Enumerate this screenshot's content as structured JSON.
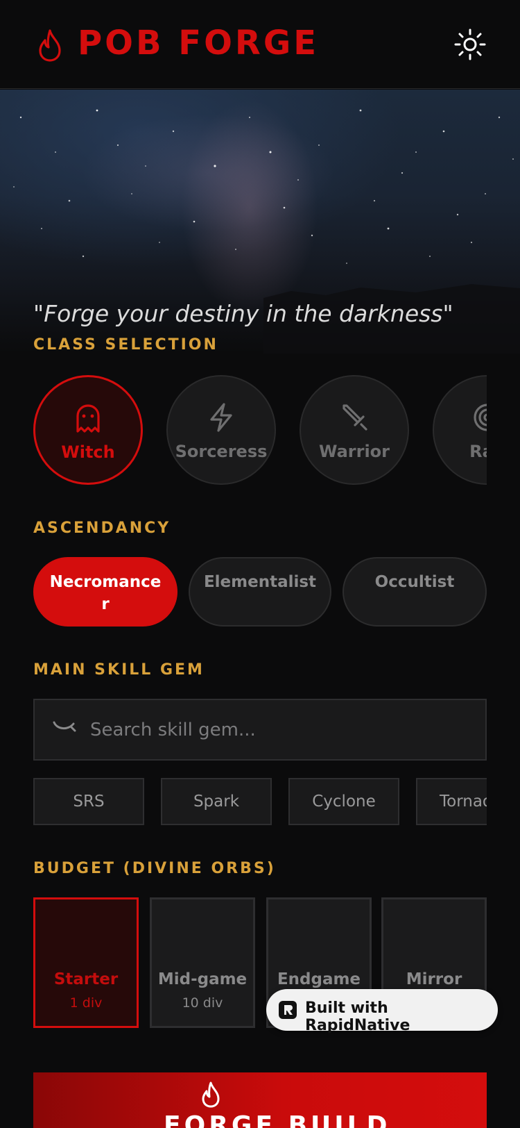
{
  "header": {
    "title": "POB FORGE",
    "logo_icon": "flame-icon",
    "theme_icon": "sun-icon"
  },
  "hero": {
    "quote": "\"Forge your destiny in the darkness\""
  },
  "class_selection": {
    "label": "CLASS SELECTION",
    "items": [
      {
        "label": "Witch",
        "icon": "ghost-icon",
        "active": true
      },
      {
        "label": "Sorceress",
        "icon": "lightning-icon",
        "active": false
      },
      {
        "label": "Warrior",
        "icon": "sword-icon",
        "active": false
      },
      {
        "label": "Ran",
        "icon": "target-icon",
        "active": false
      }
    ]
  },
  "ascendancy": {
    "label": "ASCENDANCY",
    "items": [
      {
        "line1": "Necromance",
        "line2": "r",
        "active": true
      },
      {
        "line1": "Elementalist",
        "line2": "",
        "active": false
      },
      {
        "line1": "Occultist",
        "line2": "",
        "active": false
      }
    ]
  },
  "main_skill_gem": {
    "label": "MAIN SKILL GEM",
    "search_placeholder": "Search skill gem...",
    "chips": [
      "SRS",
      "Spark",
      "Cyclone",
      "Tornad"
    ]
  },
  "budget": {
    "label": "BUDGET (DIVINE ORBS)",
    "items": [
      {
        "name": "Starter",
        "sub": "1 div",
        "active": true
      },
      {
        "name": "Mid-game",
        "sub": "10 div",
        "active": false
      },
      {
        "name": "Endgame",
        "sub": "",
        "active": false
      },
      {
        "name": "Mirror",
        "sub": "",
        "active": false
      }
    ]
  },
  "badge": {
    "text": "Built with RapidNative"
  },
  "forge_button": {
    "label": "FORGE BUILD"
  },
  "colors": {
    "accent": "#d40d0d",
    "section_label": "#d9a13a",
    "background": "#0b0b0c"
  }
}
